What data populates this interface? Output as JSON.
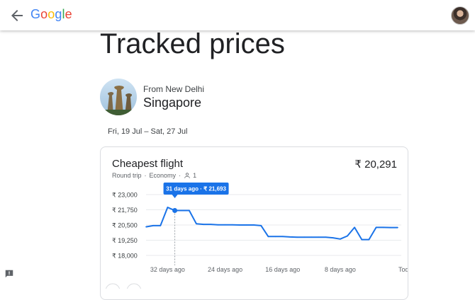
{
  "header": {
    "logo_letters": [
      {
        "ch": "G",
        "color": "#4285F4"
      },
      {
        "ch": "o",
        "color": "#EA4335"
      },
      {
        "ch": "o",
        "color": "#FBBC05"
      },
      {
        "ch": "g",
        "color": "#4285F4"
      },
      {
        "ch": "l",
        "color": "#34A853"
      },
      {
        "ch": "e",
        "color": "#EA4335"
      }
    ],
    "back_icon": "arrow-back-icon",
    "avatar_icon": "account-avatar"
  },
  "page": {
    "title": "Tracked prices"
  },
  "trip": {
    "from_label": "From New Delhi",
    "destination": "Singapore",
    "dates": "Fri, 19 Jul – Sat, 27 Jul"
  },
  "card": {
    "title": "Cheapest flight",
    "price": "₹ 20,291",
    "trip_type": "Round trip",
    "cabin": "Economy",
    "separator": "·",
    "passengers": "1",
    "tooltip": "31 days ago · ₹ 21,693"
  },
  "colors": {
    "accent": "#1a73e8",
    "grid": "#e8eaed",
    "text_secondary": "#5f6368"
  },
  "chart_data": {
    "type": "line",
    "title": "",
    "xlabel": "",
    "ylabel": "",
    "yticks": [
      "₹ 23,000",
      "₹ 21,750",
      "₹ 20,500",
      "₹ 19,250",
      "₹ 18,000"
    ],
    "ylim": [
      18000,
      23000
    ],
    "xlim": [
      -35,
      0
    ],
    "xticks": [
      {
        "label": "32 days ago",
        "x": -32
      },
      {
        "label": "24 days ago",
        "x": -24
      },
      {
        "label": "16 days ago",
        "x": -16
      },
      {
        "label": "8 days ago",
        "x": -8
      },
      {
        "label": "Today",
        "x": 0
      }
    ],
    "grid": true,
    "highlight": {
      "x": -31,
      "y": 21693
    },
    "series": [
      {
        "x": [
          -35,
          -34,
          -33,
          -32,
          -31,
          -30,
          -29,
          -28,
          -27,
          -26,
          -25,
          -24,
          -23,
          -22,
          -21,
          -20,
          -19,
          -18,
          -17,
          -16,
          -15,
          -14,
          -13,
          -12,
          -11,
          -10,
          -9,
          -8,
          -7,
          -6,
          -5,
          -4,
          -3,
          -2,
          -1,
          0
        ],
        "values": [
          20350,
          20450,
          20450,
          21950,
          21693,
          21693,
          21693,
          20600,
          20550,
          20550,
          20520,
          20520,
          20520,
          20500,
          20500,
          20500,
          20450,
          19550,
          19550,
          19550,
          19520,
          19500,
          19500,
          19500,
          19500,
          19500,
          19450,
          19350,
          19600,
          20300,
          19300,
          19300,
          20300,
          20300,
          20291,
          20291
        ]
      }
    ]
  }
}
